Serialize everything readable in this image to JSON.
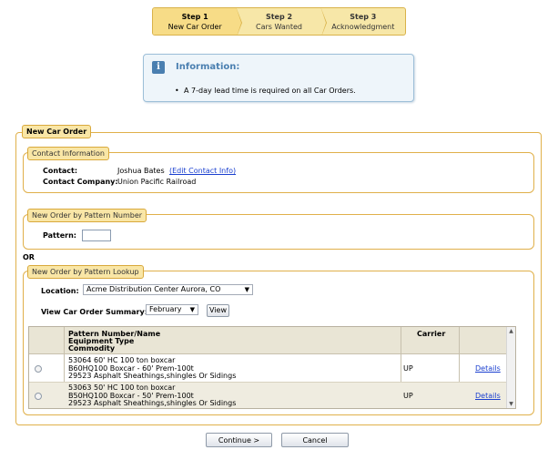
{
  "wizard": {
    "steps": [
      {
        "num": "Step 1",
        "label": "New Car Order"
      },
      {
        "num": "Step 2",
        "label": "Cars Wanted"
      },
      {
        "num": "Step 3",
        "label": "Acknowledgment"
      }
    ]
  },
  "info": {
    "title": "Information:",
    "icon_letter": "i",
    "item": "A 7-day lead time is required on all Car Orders."
  },
  "main": {
    "legend": "New Car Order",
    "contact": {
      "legend": "Contact Information",
      "contact_label": "Contact:",
      "contact_value": "Joshua Bates",
      "edit_link": "(Edit Contact Info)",
      "company_label": "Contact Company:",
      "company_value": "Union Pacific Railroad"
    },
    "pattern_number": {
      "legend": "New Order by Pattern Number",
      "pattern_label": "Pattern:"
    },
    "or_label": "OR",
    "lookup": {
      "legend": "New Order by Pattern Lookup",
      "location_label": "Location:",
      "location_value": "Acme Distribution Center Aurora, CO",
      "summary_label": "View Car Order Summary:",
      "month_value": "February",
      "view_button": "View"
    },
    "table": {
      "headers": {
        "pattern": "Pattern Number/Name",
        "equipment": "Equipment Type",
        "commodity": "Commodity",
        "carrier": "Carrier"
      },
      "rows": [
        {
          "pattern": "53064 60' HC 100 ton boxcar",
          "equipment": "B60HQ100 Boxcar - 60' Prem-100t",
          "commodity": "29523 Asphalt Sheathings,shingles Or Sidings",
          "carrier": "UP",
          "details": "Details"
        },
        {
          "pattern": "53063 50' HC 100 ton boxcar",
          "equipment": "B50HQ100 Boxcar - 50' Prem-100t",
          "commodity": "29523 Asphalt Sheathings,shingles Or Sidings",
          "carrier": "UP",
          "details": "Details"
        }
      ]
    }
  },
  "buttons": {
    "continue": "Continue >",
    "cancel": "Cancel"
  }
}
